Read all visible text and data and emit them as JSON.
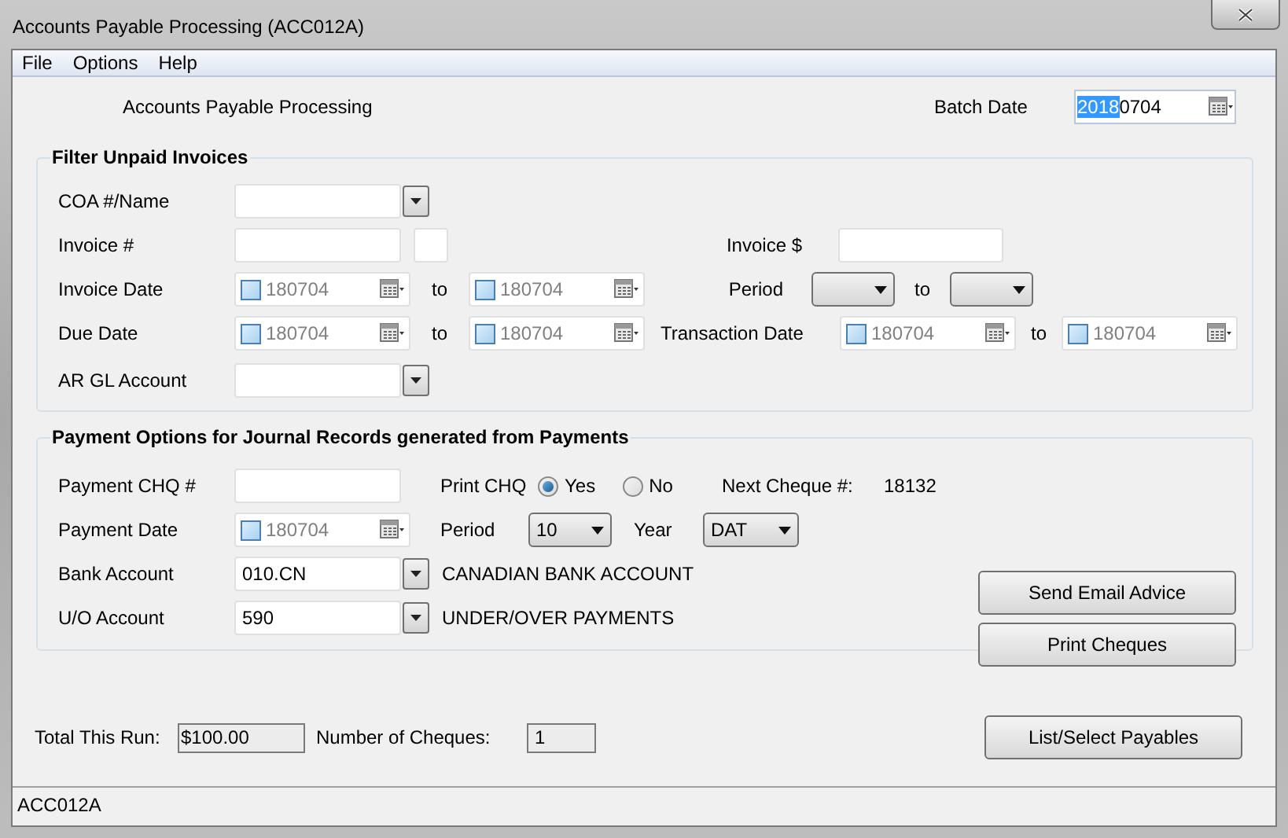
{
  "window": {
    "title": "Accounts Payable Processing (ACC012A)"
  },
  "menu": [
    "File",
    "Options",
    "Help"
  ],
  "header": {
    "title": "Accounts Payable Processing",
    "batch_date": {
      "label": "Batch Date",
      "value_selected": "2018",
      "value_rest": "0704"
    }
  },
  "filter": {
    "title": "Filter Unpaid Invoices",
    "coa_label": "COA #/Name",
    "invoice_no_label": "Invoice #",
    "invoice_amount_label": "Invoice $",
    "invoice_date": {
      "label": "Invoice Date",
      "from": {
        "checked": false,
        "value": "180704"
      },
      "to_label": "to",
      "to": {
        "checked": false,
        "value": "180704"
      }
    },
    "period": {
      "label": "Period",
      "to_label": "to"
    },
    "due_date": {
      "label": "Due Date",
      "from": {
        "checked": false,
        "value": "180704"
      },
      "to_label": "to",
      "to": {
        "checked": false,
        "value": "180704"
      }
    },
    "transaction_date": {
      "label": "Transaction Date",
      "from": {
        "checked": false,
        "value": "180704"
      },
      "to_label": "to",
      "to": {
        "checked": false,
        "value": "180704"
      }
    },
    "ar_gl_label": "AR GL Account"
  },
  "payment": {
    "title": "Payment Options for Journal Records generated from Payments",
    "chq_label": "Payment CHQ #",
    "print_chq": {
      "label": "Print CHQ",
      "options": [
        {
          "label": "Yes",
          "selected": true
        },
        {
          "label": "No",
          "selected": false
        }
      ]
    },
    "next_cheque": {
      "label": "Next Cheque #:",
      "value": "18132"
    },
    "payment_date": {
      "label": "Payment Date",
      "date": {
        "checked": false,
        "value": "180704"
      }
    },
    "period": {
      "label": "Period",
      "value": "10"
    },
    "year": {
      "label": "Year",
      "value": "DAT"
    },
    "bank_account": {
      "label": "Bank Account",
      "value": "010.CN",
      "description": "CANADIAN BANK ACCOUNT"
    },
    "uo_account": {
      "label": "U/O Account",
      "value": "590",
      "description": "UNDER/OVER PAYMENTS"
    },
    "buttons": [
      "Send Email Advice",
      "Print Cheques"
    ]
  },
  "footer": {
    "total": {
      "label": "Total This Run:",
      "value": "$100.00"
    },
    "cheques": {
      "label": "Number of Cheques:",
      "value": "1"
    },
    "button": "List/Select Payables"
  },
  "status_bar": "ACC012A"
}
